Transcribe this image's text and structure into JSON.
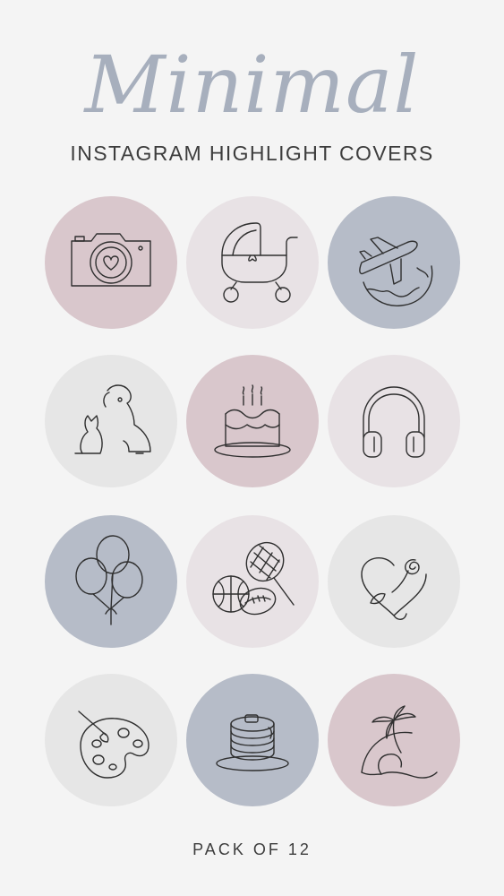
{
  "title": "Minimal",
  "subtitle": "INSTAGRAM  HIGHLIGHT COVERS",
  "footer": "PACK OF 12",
  "colors": {
    "background": "#f4f4f4",
    "mauve": "#d9c7cc",
    "blush": "#e8e2e5",
    "slate": "#b6bcc8",
    "light_gray": "#e6e6e6",
    "title": "#a7afbd",
    "line": "#2f2f2f"
  },
  "covers": [
    {
      "icon": "camera-heart-icon",
      "bg": "#d9c7cc"
    },
    {
      "icon": "baby-stroller-icon",
      "bg": "#e8e2e5"
    },
    {
      "icon": "airplane-globe-icon",
      "bg": "#b6bcc8"
    },
    {
      "icon": "cat-dog-icon",
      "bg": "#e6e6e6"
    },
    {
      "icon": "birthday-cake-icon",
      "bg": "#d9c7cc"
    },
    {
      "icon": "headphones-icon",
      "bg": "#e8e2e5"
    },
    {
      "icon": "balloons-icon",
      "bg": "#b6bcc8"
    },
    {
      "icon": "sports-balls-racket-icon",
      "bg": "#e8e2e5"
    },
    {
      "icon": "heart-rose-icon",
      "bg": "#e6e6e6"
    },
    {
      "icon": "paint-palette-icon",
      "bg": "#e6e6e6"
    },
    {
      "icon": "pancakes-icon",
      "bg": "#b6bcc8"
    },
    {
      "icon": "palm-wave-icon",
      "bg": "#d9c7cc"
    }
  ]
}
